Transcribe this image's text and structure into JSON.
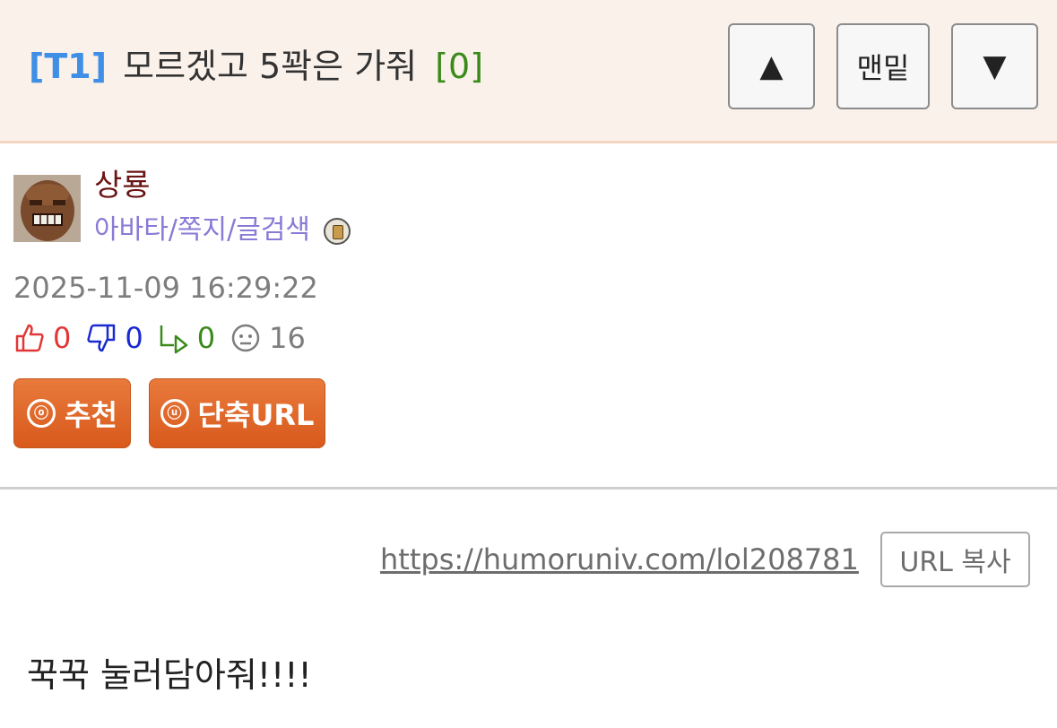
{
  "header": {
    "tag": "[T1]",
    "title": "모르겠고 5꽉은 가줘",
    "comment_count": "[0]",
    "nav": {
      "up_label": "▲",
      "bottom_label": "맨밑",
      "down_label": "▼"
    }
  },
  "author": {
    "name": "상룡",
    "links": "아바타/쪽지/글검색",
    "level_icon": "level-badge-icon"
  },
  "post": {
    "date": "2025-11-09 16:29:22",
    "stats": {
      "likes": "0",
      "dislikes": "0",
      "shares": "0",
      "views": "16"
    },
    "buttons": {
      "recommend": "추천",
      "recommend_icon": "ⓞ",
      "shorturl": "단축URL",
      "shorturl_icon": "ⓤ"
    },
    "url": "https://humoruniv.com/lol208781",
    "copy_label": "URL 복사",
    "content": "꾹꾹 눌러담아줘!!!!"
  },
  "colors": {
    "header_bg": "#f9f1ea",
    "tag_blue": "#3f8fe6",
    "count_green": "#3a8a1a",
    "author_name": "#6a1414",
    "author_links": "#8a7ad6",
    "button_orange": "#de6224",
    "like_red": "#e23636",
    "dislike_blue": "#1a2ad0"
  }
}
